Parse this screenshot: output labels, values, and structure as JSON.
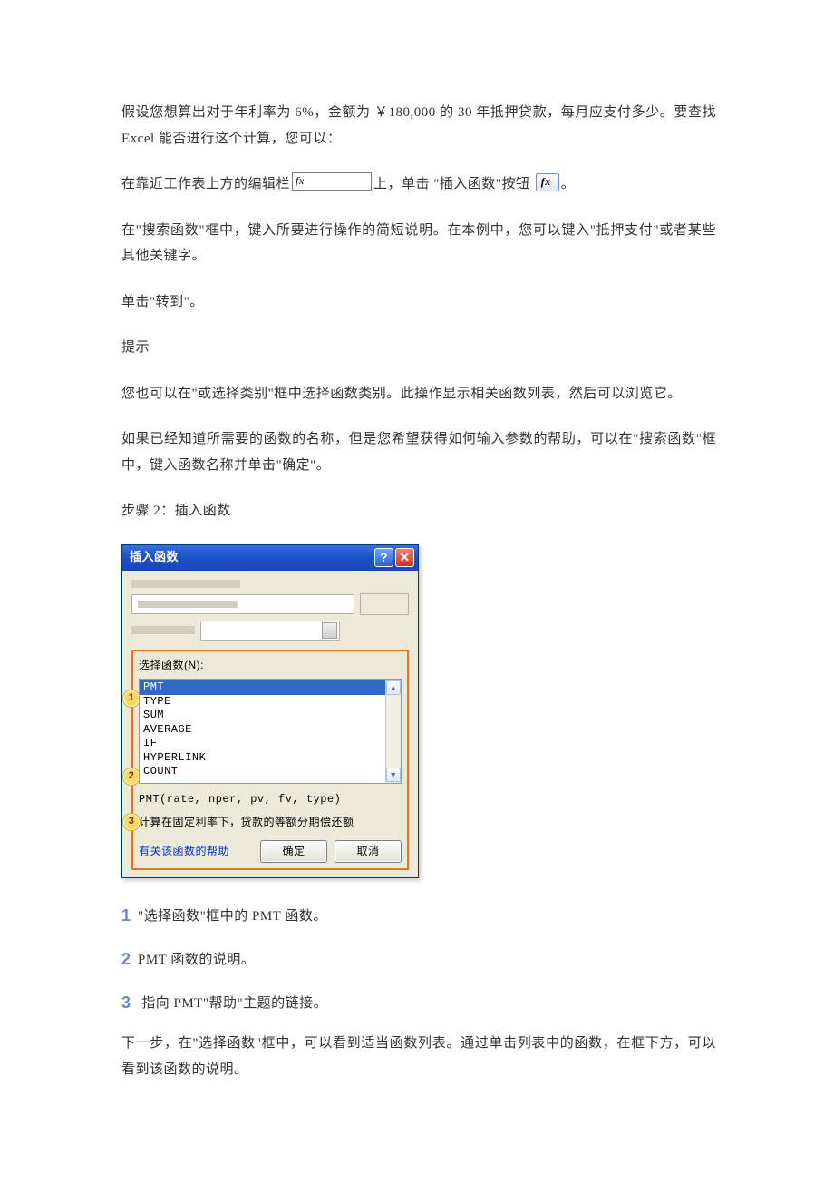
{
  "paragraphs": {
    "p1": "假设您想算出对于年利率为 6%，金额为 ￥180,000 的 30 年抵押贷款，每月应支付多少。要查找 Excel 能否进行这个计算，您可以：",
    "p2_a": "在靠近工作表上方的编辑栏",
    "p2_b": "上，单击 \"插入函数\"按钮",
    "p2_c": "。",
    "p3": "在\"搜索函数\"框中，键入所要进行操作的简短说明。在本例中，您可以键入\"抵押支付\"或者某些其他关键字。",
    "p4": "单击\"转到\"。",
    "p5": "提示",
    "p6": "您也可以在\"或选择类别\"框中选择函数类别。此操作显示相关函数列表，然后可以浏览它。",
    "p7": "如果已经知道所需要的函数的名称，但是您希望获得如何输入参数的帮助，可以在\"搜索函数\"框中，键入函数名称并单击\"确定\"。",
    "p8": "步骤 2：插入函数",
    "p_after_legend": "下一步，在\"选择函数\"框中，可以看到适当函数列表。通过单击列表中的函数，在框下方，可以看到该函数的说明。"
  },
  "dialog": {
    "title": "插入函数",
    "select_label": "选择函数(N):",
    "functions": [
      "PMT",
      "TYPE",
      "SUM",
      "AVERAGE",
      "IF",
      "HYPERLINK",
      "COUNT"
    ],
    "syntax": "PMT(rate, nper, pv, fv, type)",
    "description": "计算在固定利率下，贷款的等额分期偿还额",
    "help_link": "有关该函数的帮助",
    "ok": "确定",
    "cancel": "取消"
  },
  "callouts": {
    "c1": "1",
    "c2": "2",
    "c3": "3"
  },
  "legend": {
    "l1": "\"选择函数\"框中的 PMT 函数。",
    "l2": "PMT 函数的说明。",
    "l3": " 指向 PMT\"帮助\"主题的链接。"
  }
}
